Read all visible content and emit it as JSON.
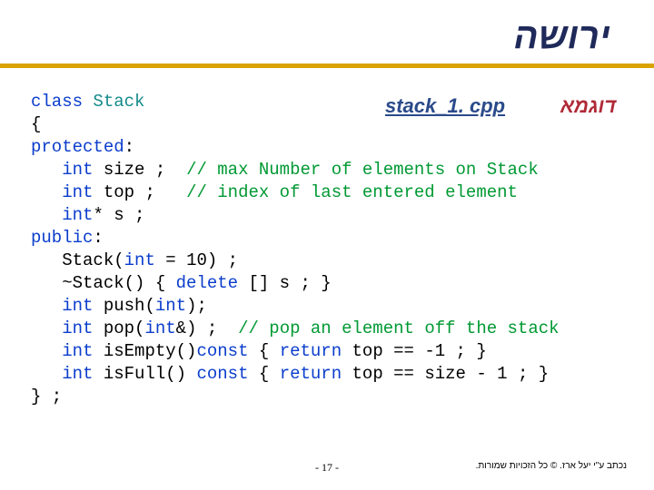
{
  "title": "ירושה",
  "label": "דוגמא",
  "filelink": "stack_1. cpp",
  "code": {
    "line1": {
      "kw": "class",
      "name": " Stack"
    },
    "line2": "{",
    "line3": {
      "kw": "protected",
      "colon": ":"
    },
    "line4": {
      "indent": "   ",
      "kw": "int",
      "rest": " size ;",
      "comment": "  // max Number of elements on Stack"
    },
    "line5": {
      "indent": "   ",
      "kw": "int",
      "rest": " top ;",
      "comment": "   // index of last entered element"
    },
    "line6": {
      "indent": "   ",
      "kw": "int",
      "rest": "* s ;"
    },
    "line7": {
      "kw": "public",
      "colon": ":"
    },
    "line8": {
      "indent": "   ",
      "pre": "Stack(",
      "kw": "int",
      "rest": " = 10) ;"
    },
    "line9": {
      "indent": "   ",
      "pre": "~Stack() { ",
      "kw": "delete",
      "rest": " [] s ; }"
    },
    "line10": {
      "indent": "   ",
      "kw": "int",
      "rest": " push(",
      "kw2": "int",
      "rest2": ");"
    },
    "line11": {
      "indent": "   ",
      "kw": "int",
      "rest": " pop(",
      "kw2": "int",
      "rest2": "&) ;",
      "comment": "  // pop an element off the stack"
    },
    "line12": {
      "indent": "   ",
      "kw": "int",
      "rest": " isEmpty()",
      "kw2": "const",
      "rest2": " { ",
      "kw3": "return",
      "rest3": " top == -1 ; }"
    },
    "line13": {
      "indent": "   ",
      "kw": "int",
      "rest": " isFull() ",
      "kw2": "const",
      "rest2": " { ",
      "kw3": "return",
      "rest3": " top == size - 1 ; }"
    },
    "line14": "} ;"
  },
  "footer": {
    "pagenum": "- 17 -",
    "copyright": "נכתב ע\"י יעל ארז. © כל הזכויות שמורות."
  }
}
